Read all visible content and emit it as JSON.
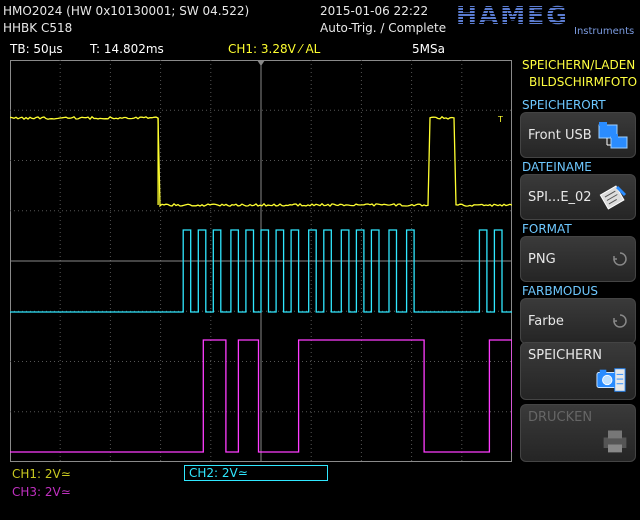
{
  "header": {
    "model": "HMO2024 (HW 0x10130001; SW 04.522)",
    "probe": "HHBK C518",
    "datetime": "2015-01-06 22:22",
    "trigger_state": "Auto-Trig. / Complete",
    "brand": "HAMEG",
    "brand_sub": "Instruments"
  },
  "status": {
    "timebase": "TB: 50µs",
    "trigger_time": "T: 14.802ms",
    "ch1_trigger": "CH1: 3.28V ⁄ AL",
    "sample_rate": "5MSa"
  },
  "colors": {
    "ch1": "#ffff30",
    "ch2": "#30e8ff",
    "ch3": "#ff3cff",
    "accent": "#6ec8ff"
  },
  "waveforms": {
    "ch1": {
      "low": 0.72,
      "high": 0.95,
      "edges": [
        0.0,
        0.295,
        0.835,
        0.885
      ]
    },
    "ch2": {
      "low": 0.2,
      "high": 1.0,
      "pulses": [
        [
          0.345,
          0.36
        ],
        [
          0.375,
          0.39
        ],
        [
          0.405,
          0.42
        ],
        [
          0.44,
          0.455
        ],
        [
          0.47,
          0.485
        ],
        [
          0.5,
          0.515
        ],
        [
          0.53,
          0.545
        ],
        [
          0.56,
          0.575
        ],
        [
          0.595,
          0.61
        ],
        [
          0.625,
          0.64
        ],
        [
          0.66,
          0.675
        ],
        [
          0.69,
          0.705
        ],
        [
          0.72,
          0.735
        ],
        [
          0.755,
          0.77
        ],
        [
          0.79,
          0.805
        ],
        [
          0.935,
          0.95
        ],
        [
          0.965,
          0.98
        ]
      ],
      "busy_start": 0.34,
      "busy_end": 0.82
    },
    "ch3": {
      "low": 0.04,
      "high": 1.0,
      "pulses": [
        [
          0.385,
          0.43
        ],
        [
          0.455,
          0.495
        ],
        [
          0.575,
          0.825
        ],
        [
          0.955,
          1.0
        ]
      ]
    }
  },
  "sidebar": {
    "title_1": "SPEICHERN/LADEN",
    "title_2": "BILDSCHIRMFOTO",
    "items": [
      {
        "title": "SPEICHERORT",
        "value": "Front USB",
        "icon": "usb-folder-icon"
      },
      {
        "title": "DATEINAME",
        "value": "SPI...E_02",
        "icon": "edit-note-icon"
      },
      {
        "title": "FORMAT",
        "value": "PNG",
        "icon": "cycle-icon"
      },
      {
        "title": "FARBMODUS",
        "value": "Farbe",
        "icon": "cycle-icon"
      }
    ],
    "save_label": "SPEICHERN",
    "print_label": "DRUCKEN"
  },
  "channels": {
    "ch1": "CH1: 2V≃",
    "ch2": "CH2: 2V≃",
    "ch3": "CH3: 2V≃"
  }
}
